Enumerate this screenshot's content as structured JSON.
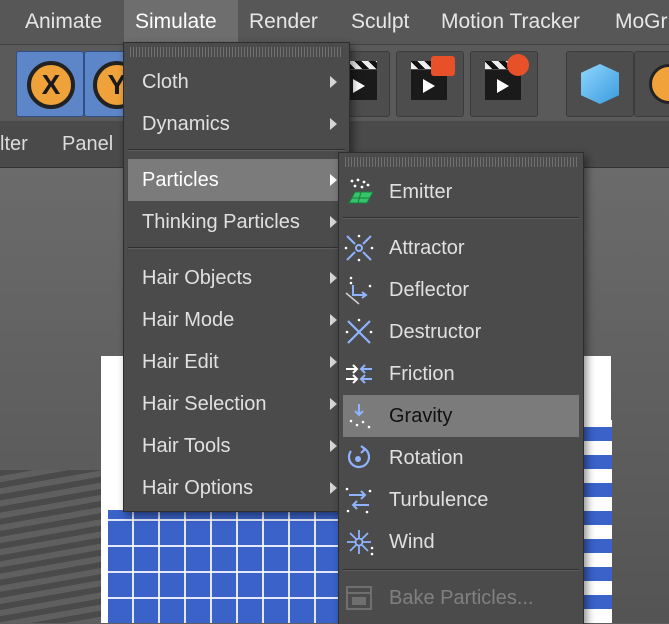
{
  "menubar": {
    "items": [
      "Animate",
      "Simulate",
      "Render",
      "Sculpt",
      "Motion Tracker",
      "MoGr"
    ]
  },
  "toolbar": {
    "axis_x": "X",
    "axis_y": "Y"
  },
  "subbar": {
    "left": "lter",
    "panel": "Panel"
  },
  "simulate_menu": {
    "items": [
      {
        "label": "Cloth"
      },
      {
        "label": "Dynamics"
      },
      {
        "label": "Particles"
      },
      {
        "label": "Thinking Particles"
      },
      {
        "label": "Hair Objects"
      },
      {
        "label": "Hair Mode"
      },
      {
        "label": "Hair Edit"
      },
      {
        "label": "Hair Selection"
      },
      {
        "label": "Hair Tools"
      },
      {
        "label": "Hair Options"
      }
    ]
  },
  "particles_menu": {
    "items": [
      {
        "label": "Emitter",
        "icon": "emitter-icon"
      },
      {
        "label": "Attractor",
        "icon": "attractor-icon"
      },
      {
        "label": "Deflector",
        "icon": "deflector-icon"
      },
      {
        "label": "Destructor",
        "icon": "destructor-icon"
      },
      {
        "label": "Friction",
        "icon": "friction-icon"
      },
      {
        "label": "Gravity",
        "icon": "gravity-icon"
      },
      {
        "label": "Rotation",
        "icon": "rotation-icon"
      },
      {
        "label": "Turbulence",
        "icon": "turbulence-icon"
      },
      {
        "label": "Wind",
        "icon": "wind-icon"
      },
      {
        "label": "Bake Particles...",
        "icon": "bake-particles-icon"
      }
    ]
  },
  "colors": {
    "highlight": "#7b7b7b",
    "icon_blue": "#8fb3ff",
    "emitter_green": "#35c46a",
    "viewport_tile_blue": "#3a62c9"
  }
}
